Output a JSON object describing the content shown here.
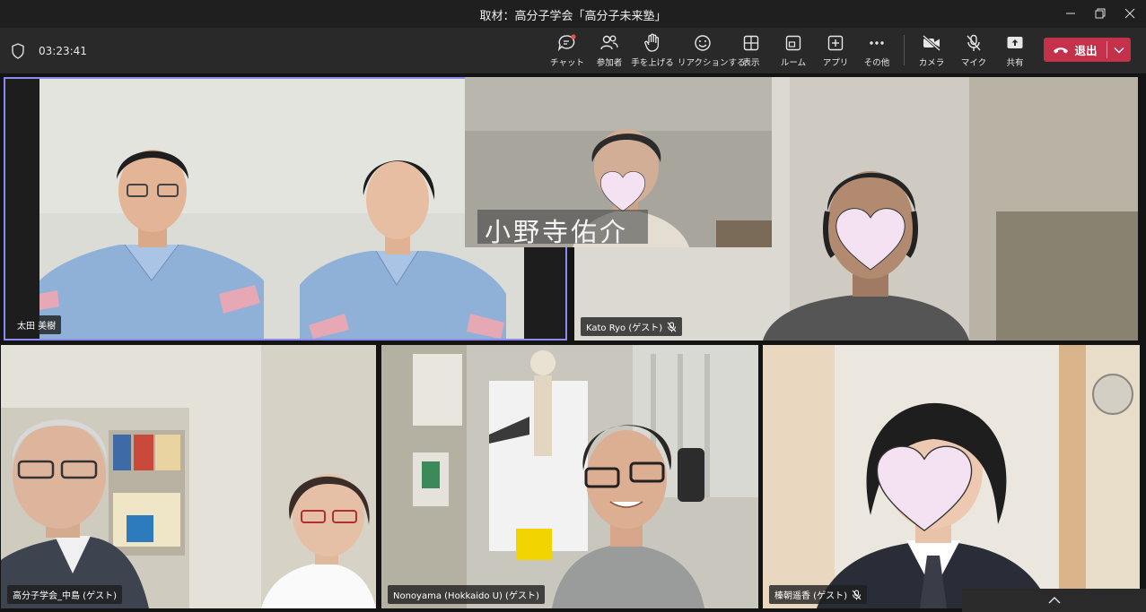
{
  "window": {
    "title": "取材：高分子学会「高分子未来塾」",
    "controls": [
      "minimize-icon",
      "restore-icon",
      "close-icon"
    ]
  },
  "meeting": {
    "timer": "03:23:41",
    "toolbar": [
      {
        "id": "chat",
        "label": "チャット",
        "icon": "chat-icon"
      },
      {
        "id": "participants",
        "label": "参加者",
        "icon": "people-icon"
      },
      {
        "id": "raise-hand",
        "label": "手を上げる",
        "icon": "hand-icon"
      },
      {
        "id": "reactions",
        "label": "リアクションする",
        "icon": "smiley-icon"
      },
      {
        "id": "view",
        "label": "表示",
        "icon": "grid-icon"
      },
      {
        "id": "rooms",
        "label": "ルーム",
        "icon": "rooms-icon"
      },
      {
        "id": "apps",
        "label": "アプリ",
        "icon": "plus-icon"
      },
      {
        "id": "more",
        "label": "その他",
        "icon": "more-icon"
      },
      {
        "id": "camera",
        "label": "カメラ",
        "icon": "camera-off-icon"
      },
      {
        "id": "mic",
        "label": "マイク",
        "icon": "mic-off-icon"
      },
      {
        "id": "share",
        "label": "共有",
        "icon": "share-icon"
      }
    ],
    "leave_label": "退出",
    "accent": "#c4314b",
    "active_speaker_border": "#8b8bf0"
  },
  "participants": {
    "p1": {
      "name": "太田 美樹"
    },
    "p2": {
      "name": "小野寺佑介"
    },
    "p3": {
      "name": "Kato Ryo (ゲスト)",
      "muted": true
    },
    "p4": {
      "name": "高分子学会_中島 (ゲスト)"
    },
    "p5": {
      "name": "Nonoyama (Hokkaido U) (ゲスト)"
    },
    "p6": {
      "name": "榛朝遥香 (ゲスト)",
      "muted": true
    }
  }
}
